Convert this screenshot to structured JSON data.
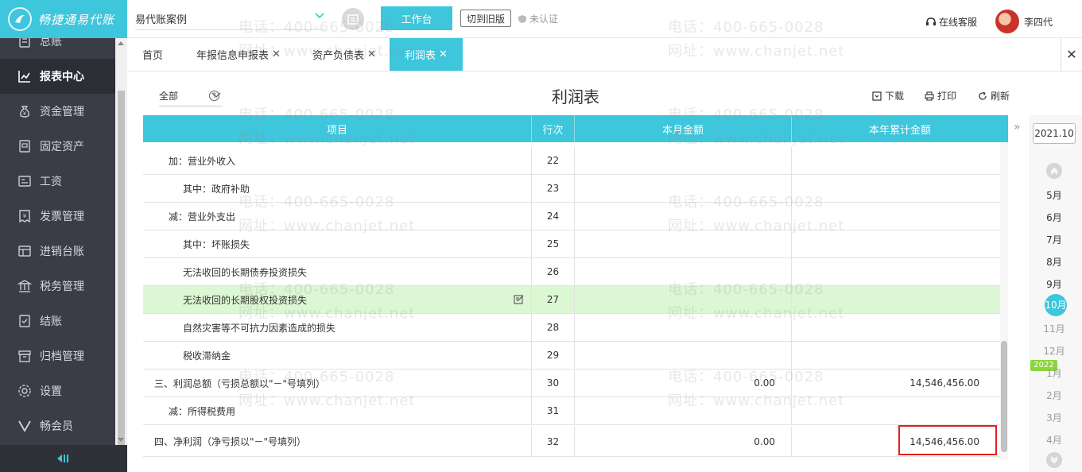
{
  "app": {
    "logo_text": "畅捷通易代账"
  },
  "topbar": {
    "company": "易代账案例",
    "workbench_label": "工作台",
    "switch_old_label": "切到旧版",
    "cert_status": "未认证",
    "service_label": "在线客服",
    "username": "李四代"
  },
  "sidebar": {
    "items": [
      {
        "label": "总账",
        "icon": "ledger-icon"
      },
      {
        "label": "报表中心",
        "icon": "chart-icon",
        "active": true
      },
      {
        "label": "资金管理",
        "icon": "money-bag-icon"
      },
      {
        "label": "固定资产",
        "icon": "asset-icon"
      },
      {
        "label": "工资",
        "icon": "payroll-icon"
      },
      {
        "label": "发票管理",
        "icon": "invoice-icon"
      },
      {
        "label": "进销台账",
        "icon": "inventory-icon"
      },
      {
        "label": "税务管理",
        "icon": "tax-icon"
      },
      {
        "label": "结账",
        "icon": "checkout-icon"
      },
      {
        "label": "归档管理",
        "icon": "archive-icon"
      },
      {
        "label": "设置",
        "icon": "gear-icon"
      },
      {
        "label": "畅会员",
        "icon": "vip-icon"
      }
    ]
  },
  "tabs": [
    {
      "label": "首页",
      "closable": false
    },
    {
      "label": "年报信息申报表",
      "closable": true
    },
    {
      "label": "资产负债表",
      "closable": true
    },
    {
      "label": "利润表",
      "closable": true,
      "active": true
    }
  ],
  "report": {
    "title": "利润表",
    "filter_value": "全部",
    "help": "?",
    "download_label": "下载",
    "print_label": "打印",
    "refresh_label": "刷新",
    "headers": {
      "item": "项目",
      "line": "行次",
      "month": "本月金额",
      "year": "本年累计金额"
    },
    "rows": [
      {
        "item": "加：营业外收入",
        "line": "22",
        "month": "",
        "year": "",
        "indent": 1
      },
      {
        "item": "其中：政府补助",
        "line": "23",
        "month": "",
        "year": "",
        "indent": 2
      },
      {
        "item": "减：营业外支出",
        "line": "24",
        "month": "",
        "year": "",
        "indent": 1
      },
      {
        "item": "其中：坏账损失",
        "line": "25",
        "month": "",
        "year": "",
        "indent": 2
      },
      {
        "item": "无法收回的长期债券投资损失",
        "line": "26",
        "month": "",
        "year": "",
        "indent": 2
      },
      {
        "item": "无法收回的长期股权投资损失",
        "line": "27",
        "month": "",
        "year": "",
        "indent": 2,
        "highlight": true
      },
      {
        "item": "自然灾害等不可抗力因素造成的损失",
        "line": "28",
        "month": "",
        "year": "",
        "indent": 2
      },
      {
        "item": "税收滞纳金",
        "line": "29",
        "month": "",
        "year": "",
        "indent": 2
      },
      {
        "item": "三、利润总额（亏损总额以\"－\"号填列）",
        "line": "30",
        "month": "0.00",
        "year": "14,546,456.00",
        "indent": 0
      },
      {
        "item": "减：所得税费用",
        "line": "31",
        "month": "",
        "year": "",
        "indent": 1
      },
      {
        "item": "四、净利润（净亏损以\"－\"号填列）",
        "line": "32",
        "month": "0.00",
        "year": "14,546,456.00",
        "indent": 0
      }
    ]
  },
  "period": {
    "year": "2021.10",
    "months": [
      "5月",
      "6月",
      "7月",
      "8月",
      "9月",
      "10月",
      "11月",
      "12月",
      "1月",
      "2月",
      "3月",
      "4月"
    ],
    "selected": "10月",
    "next_year_badge": "2022"
  },
  "watermark": {
    "phone": "电话：400-665-0028",
    "site": "网址：www.chanjet.net"
  },
  "colors": {
    "accent": "#3dc6dc",
    "sidebar": "#3a3d47",
    "highlight_row": "#dcf7d3",
    "annotation_box": "#e02020"
  }
}
